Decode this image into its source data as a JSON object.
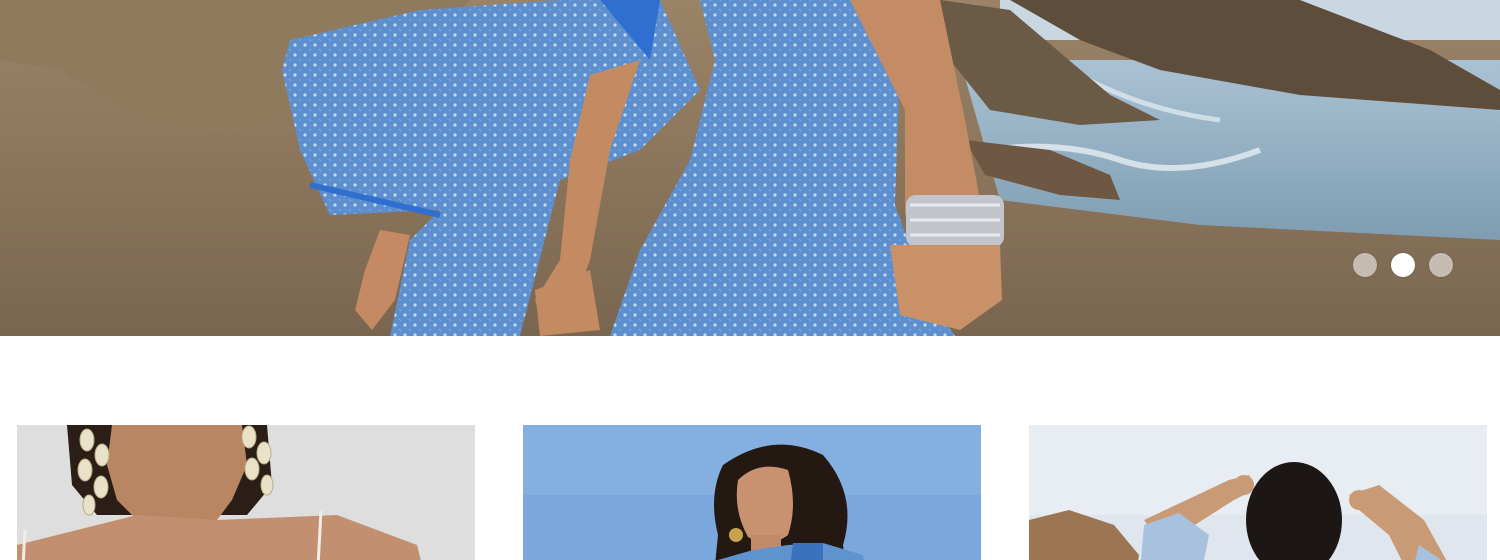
{
  "hero": {
    "slide_count": 3,
    "active_slide": 2,
    "dots": [
      "slide-1",
      "slide-2",
      "slide-3"
    ]
  },
  "products": [
    {
      "id": "product-1"
    },
    {
      "id": "product-2"
    },
    {
      "id": "product-3"
    }
  ],
  "colors": {
    "dress_blue": "#5b8fd0",
    "sand": "#8d7a63",
    "sea": "#9fb8c9",
    "card_gray": "#dcdcdc",
    "sky": "#7aa6d8"
  }
}
